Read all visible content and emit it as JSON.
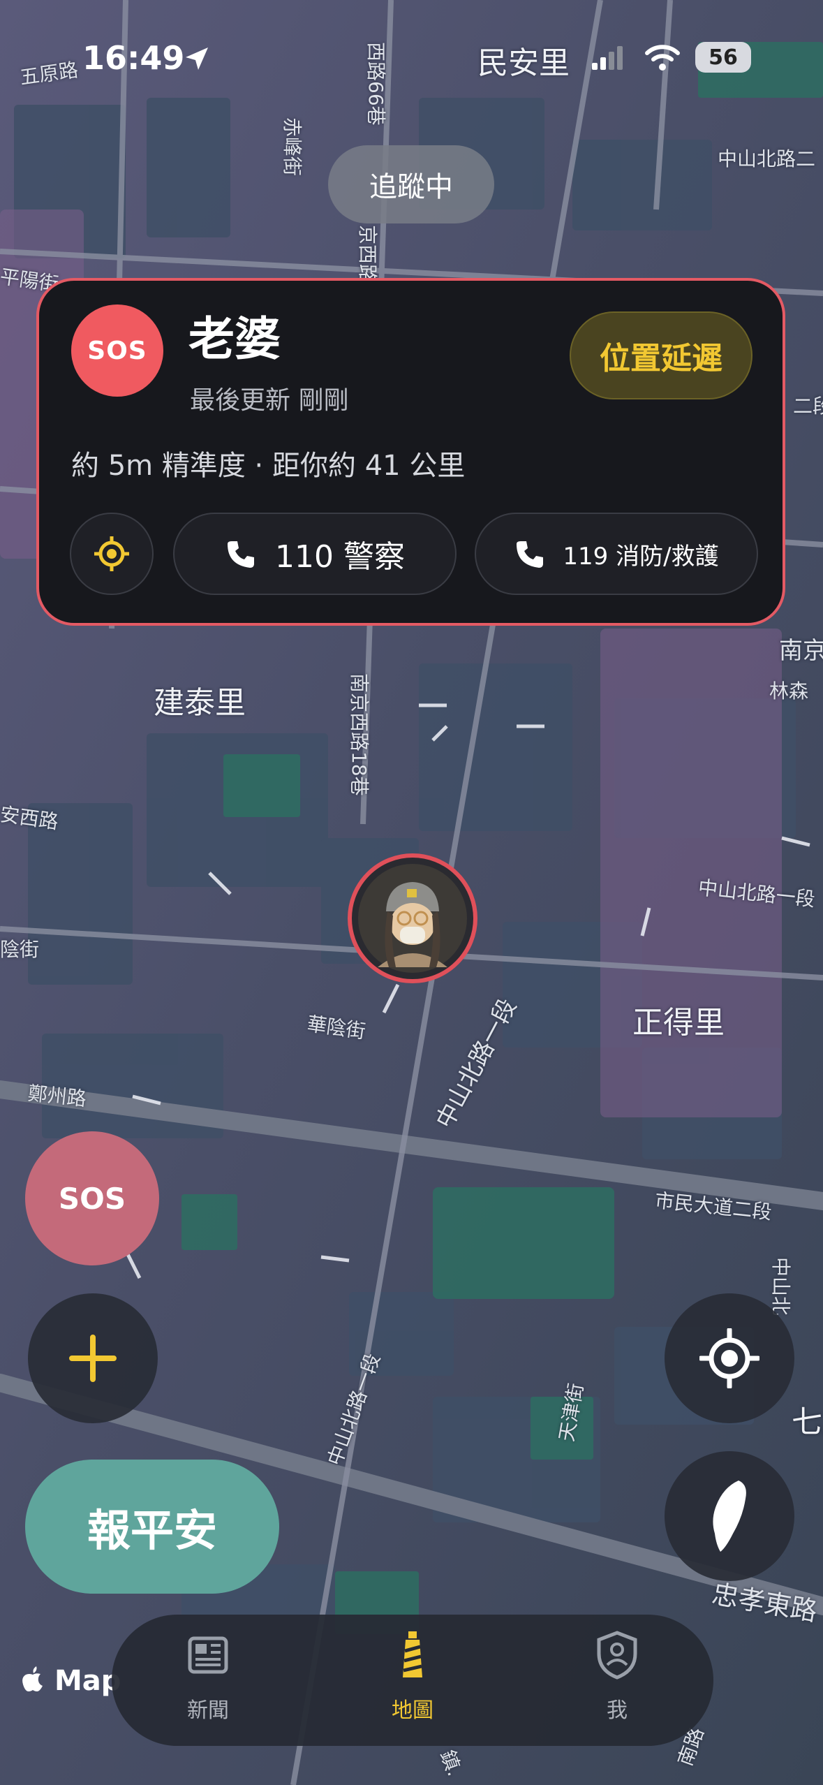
{
  "status_bar": {
    "time": "16:49",
    "battery": "56"
  },
  "map": {
    "labels": {
      "top_district": "民安里",
      "wuyuan": "五原路",
      "lane66": "西路66巷",
      "chifeng": "赤峰街",
      "zhongshan_n2": "中山北路二",
      "pingyang": "平陽街",
      "nanjing_w_top": "京西路",
      "er_duan": "二段",
      "nanjing_right": "南京",
      "linsen": "林森",
      "jiantai": "建泰里",
      "lane18": "南京西路18巷",
      "anxi": "安西路",
      "yin_st": "陰街",
      "zhongshan_n1_right": "中山北路一段",
      "huayin": "華陰街",
      "zhongshan_n1_center": "中山北路一段",
      "zhengde": "正得里",
      "zhengzhou": "鄭州路",
      "civic_blvd": "市民大道二段",
      "zhongshan_n1_lower": "中山北路一段",
      "tianjin": "天津街",
      "zhongshan_n_right": "中山北",
      "qi_li": "七里",
      "zhongxiao": "忠孝東路",
      "bottom_road": "南路",
      "bottom_zhen": "鎮."
    }
  },
  "tracking_pill": {
    "label": "追蹤中"
  },
  "contact_card": {
    "badge": "SOS",
    "name": "老婆",
    "updated": "最後更新 剛剛",
    "delay_button": "位置延遲",
    "info": "約 5m 精準度 · 距你約 41 公里",
    "police_button": "110 警察",
    "fire_button": "119 消防/救護"
  },
  "floating": {
    "sos": "SOS",
    "safe_button": "報平安"
  },
  "tab_bar": {
    "tabs": [
      {
        "label": "新聞",
        "icon": "newspaper-icon"
      },
      {
        "label": "地圖",
        "icon": "lighthouse-icon"
      },
      {
        "label": "我",
        "icon": "shield-person-icon"
      }
    ],
    "active_index": 1
  },
  "attribution": "Map",
  "colors": {
    "accent_red": "#f05a60",
    "accent_yellow": "#f2c832",
    "safe_green": "#5fa59c",
    "card_bg": "#17181d"
  }
}
